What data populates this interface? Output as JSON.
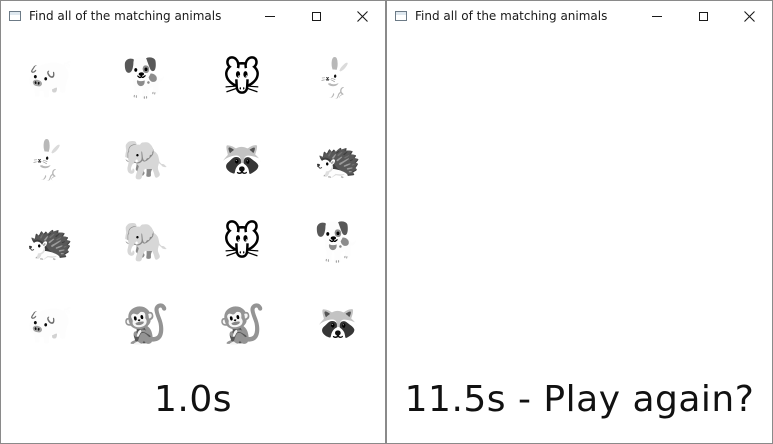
{
  "left_window": {
    "title": "Find all of the matching animals",
    "status": "1.0s",
    "grid": [
      [
        "🐖",
        "🐕",
        "🐭",
        "🐇"
      ],
      [
        "🐇",
        "🐘",
        "🦝",
        "🦔"
      ],
      [
        "🦔",
        "🐘",
        "🐭",
        "🐕"
      ],
      [
        "🐖",
        "🐒",
        "🐒",
        "🦝"
      ]
    ]
  },
  "right_window": {
    "title": "Find all of the matching animals",
    "status": "11.5s - Play again?"
  },
  "controls": {
    "minimize_icon": "minimize-icon",
    "maximize_icon": "maximize-icon",
    "close_icon": "close-icon"
  }
}
